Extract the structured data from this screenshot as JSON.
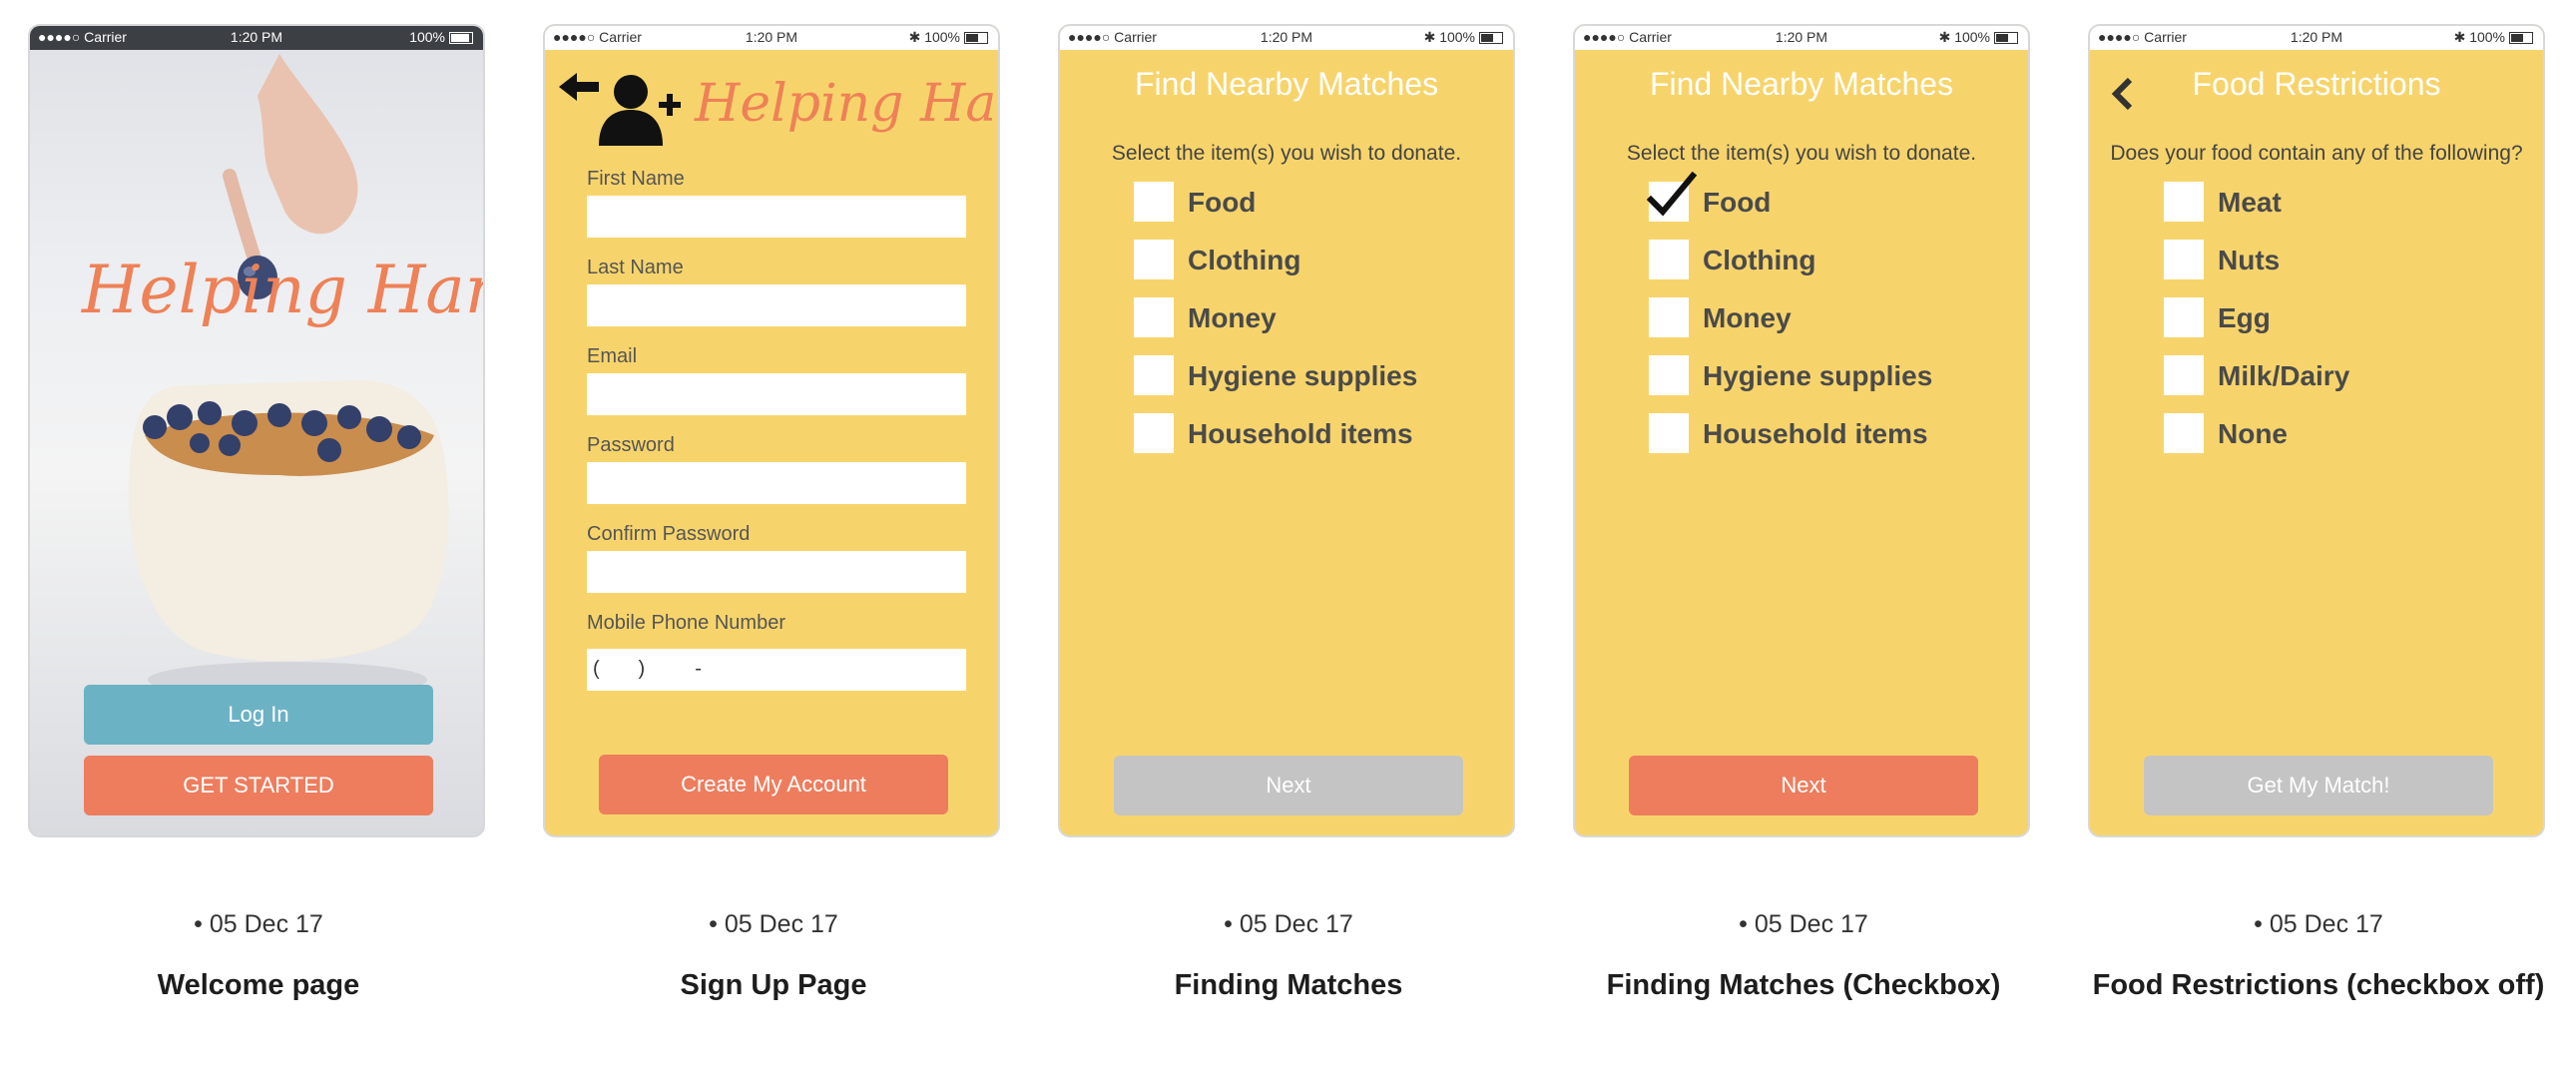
{
  "status": {
    "carrier": "●●●●○ Carrier",
    "time": "1:20 PM",
    "battery": "100%"
  },
  "cards": [
    {
      "caption": "Welcome page",
      "date": "• 05 Dec 17"
    },
    {
      "caption": "Sign Up Page",
      "date": "• 05 Dec 17"
    },
    {
      "caption": "Finding Matches",
      "date": "• 05 Dec 17"
    },
    {
      "caption": "Finding Matches (Checkbox)",
      "date": "• 05 Dec 17"
    },
    {
      "caption": "Food Restrictions (checkbox off)",
      "date": "• 05 Dec 17"
    }
  ],
  "welcome": {
    "logo": "Helping Hand",
    "login": "Log In",
    "get_started": "GET STARTED"
  },
  "signup": {
    "logo": "Helping Hand",
    "fields": [
      "First Name",
      "Last Name",
      "Email",
      "Password",
      "Confirm Password",
      "Mobile Phone Number"
    ],
    "phone_placeholder": "(       )         -",
    "submit": "Create My Account"
  },
  "find": {
    "title": "Find Nearby Matches",
    "prompt": "Select the item(s) you wish to donate.",
    "options": [
      "Food",
      "Clothing",
      "Money",
      "Hygiene supplies",
      "Household items"
    ],
    "next": "Next"
  },
  "restrictions": {
    "title": "Food Restrictions",
    "prompt": "Does your food contain any of the following?",
    "options": [
      "Meat",
      "Nuts",
      "Egg",
      "Milk/Dairy",
      "None"
    ],
    "submit": "Get My Match!"
  },
  "colors": {
    "yellow": "#f7d46b",
    "orange": "#ee7d5e",
    "blue": "#6cb2c5",
    "gray": "#c4c4c4",
    "logo": "#ee8157"
  }
}
